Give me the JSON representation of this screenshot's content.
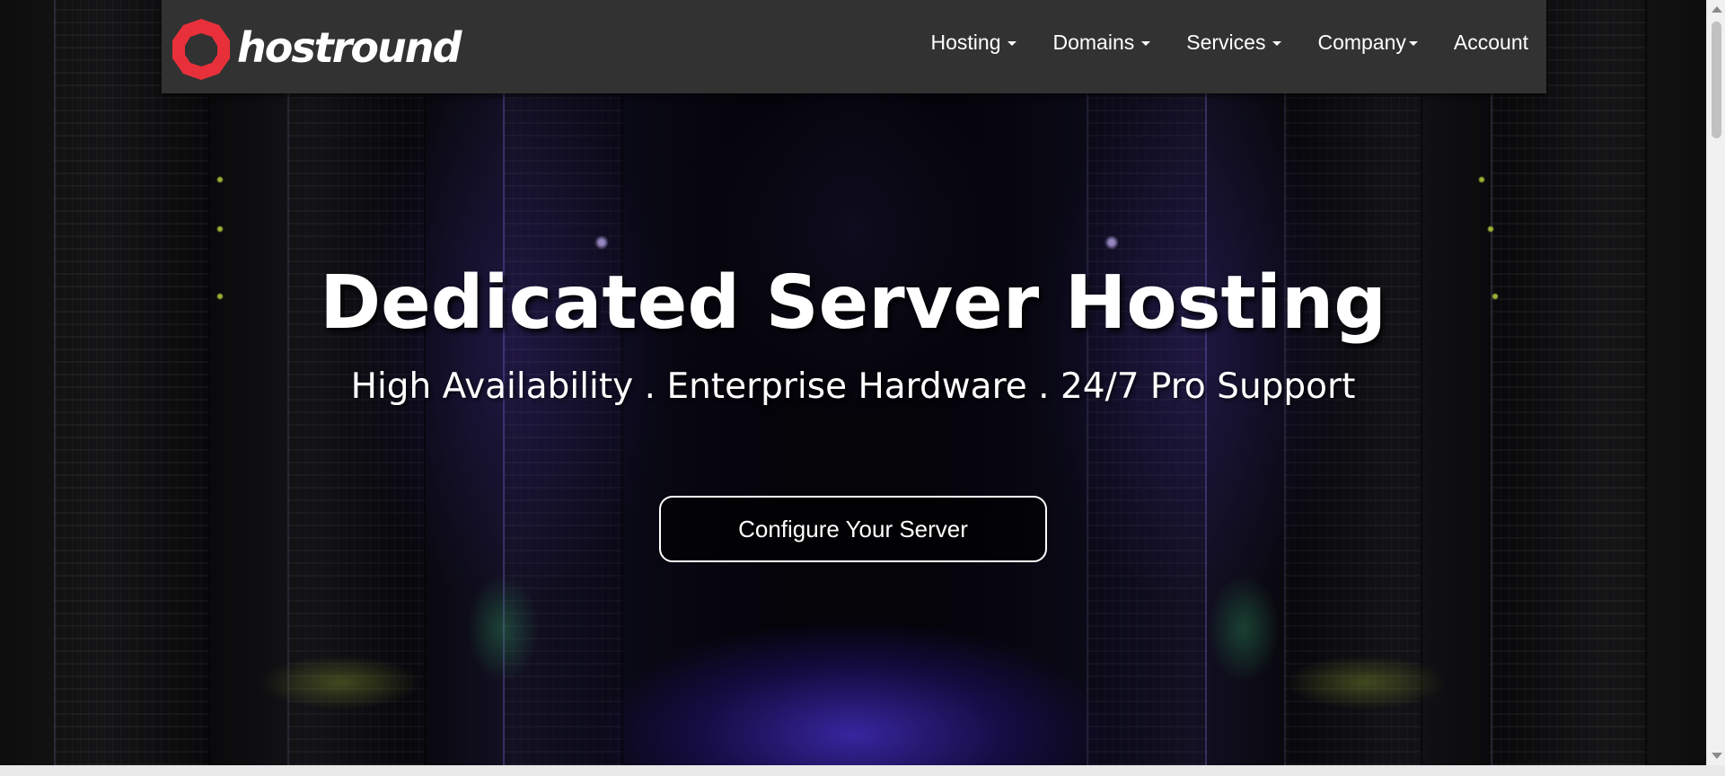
{
  "brand": {
    "name": "hostround",
    "logo_icon": "octagon-ring-logo",
    "logo_color": "#e8303a"
  },
  "nav": {
    "items": [
      {
        "label": "Hosting",
        "has_dropdown": true
      },
      {
        "label": "Domains",
        "has_dropdown": true
      },
      {
        "label": "Services",
        "has_dropdown": true
      },
      {
        "label": "Company",
        "has_dropdown": true
      },
      {
        "label": "Account",
        "has_dropdown": false
      }
    ]
  },
  "hero": {
    "title": "Dedicated Server Hosting",
    "subtitle": "High Availability . Enterprise Hardware . 24/7 Pro Support",
    "cta_label": "Configure Your Server"
  },
  "colors": {
    "navbar_bg": "#323232",
    "text": "#ffffff",
    "accent": "#e8303a"
  }
}
